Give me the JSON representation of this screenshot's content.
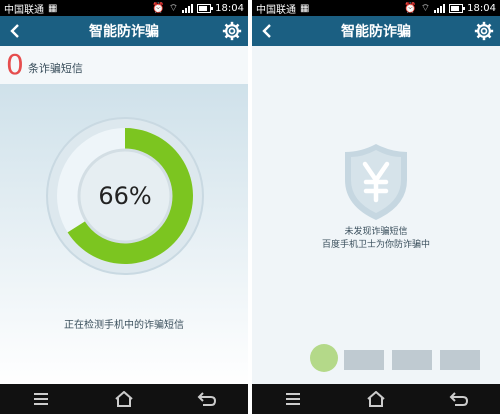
{
  "status": {
    "carrier": "中国联通",
    "time": "18:04"
  },
  "left": {
    "title": "智能防诈骗",
    "count": "0",
    "count_label": "条诈骗短信",
    "percent_label": "66%",
    "progress_fraction": 0.66,
    "progress_text": "正在检测手机中的诈骗短信"
  },
  "right": {
    "title": "智能防诈骗",
    "message_line1": "未发现诈骗短信",
    "message_line2": "百度手机卫士为你防诈骗中"
  },
  "colors": {
    "header": "#1b5f82",
    "progress_green": "#7cc520",
    "count_red": "#e64d4d"
  },
  "icons": {
    "back": "chevron-left-icon",
    "settings": "gear-icon",
    "shield": "shield-yen-icon",
    "nav_menu": "menu-icon",
    "nav_home": "home-icon",
    "nav_back": "back-arrow-icon"
  }
}
